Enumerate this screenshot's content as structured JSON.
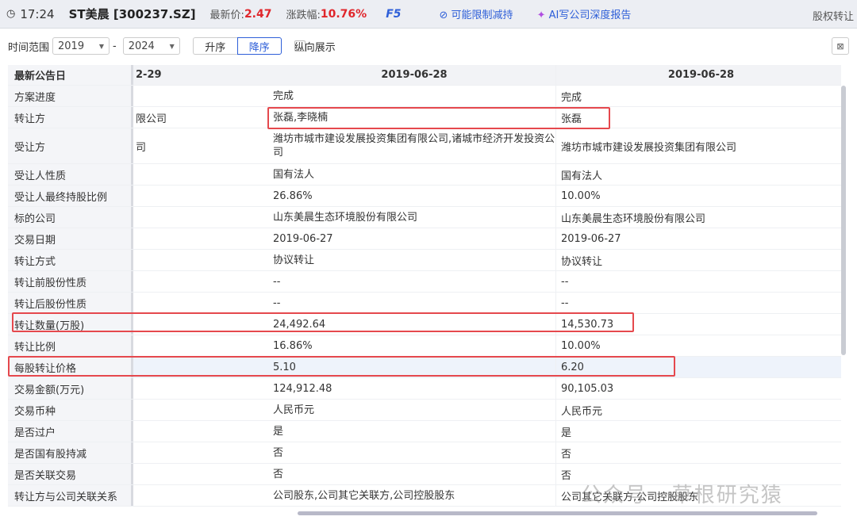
{
  "header": {
    "time": "17:24",
    "stock": "ST美晨 [300237.SZ]",
    "price_label": "最新价:",
    "price": "2.47",
    "change_label": "涨跌幅:",
    "change": "10.76%",
    "f5": "F5",
    "limit_link": "可能限制减持",
    "ai_link": "AI写公司深度报告",
    "page_title": "股权转让"
  },
  "toolbar": {
    "range_label": "时间范围",
    "from": "2019",
    "dash": "-",
    "to": "2024",
    "asc": "升序",
    "desc": "降序",
    "vertical": "纵向展示"
  },
  "table": {
    "headers": [
      "最新公告日",
      "2-29",
      "2019-06-28",
      "2019-06-28"
    ],
    "rows": [
      [
        "方案进度",
        "",
        "完成",
        "完成"
      ],
      [
        "转让方",
        "限公司",
        "张磊,李晓楠",
        "张磊"
      ],
      [
        "受让方",
        "司",
        "潍坊市城市建设发展投资集团有限公司,诸城市经济开发投资公司",
        "潍坊市城市建设发展投资集团有限公司"
      ],
      [
        "受让人性质",
        "",
        "国有法人",
        "国有法人"
      ],
      [
        "受让人最终持股比例",
        "",
        "26.86%",
        "10.00%"
      ],
      [
        "标的公司",
        "",
        "山东美晨生态环境股份有限公司",
        "山东美晨生态环境股份有限公司"
      ],
      [
        "交易日期",
        "",
        "2019-06-27",
        "2019-06-27"
      ],
      [
        "转让方式",
        "",
        "协议转让",
        "协议转让"
      ],
      [
        "转让前股份性质",
        "",
        "--",
        "--"
      ],
      [
        "转让后股份性质",
        "",
        "--",
        "--"
      ],
      [
        "转让数量(万股)",
        "",
        "24,492.64",
        "14,530.73"
      ],
      [
        "转让比例",
        "",
        "16.86%",
        "10.00%"
      ],
      [
        "每股转让价格",
        "",
        "5.10",
        "6.20"
      ],
      [
        "交易金额(万元)",
        "",
        "124,912.48",
        "90,105.03"
      ],
      [
        "交易币种",
        "",
        "人民币元",
        "人民币元"
      ],
      [
        "是否过户",
        "",
        "是",
        "是"
      ],
      [
        "是否国有股持减",
        "",
        "否",
        "否"
      ],
      [
        "是否关联交易",
        "",
        "否",
        "否"
      ],
      [
        "转让方与公司关联关系",
        "",
        "公司股东,公司其它关联方,公司控股股东",
        "公司其它关联方,公司控股股东"
      ]
    ]
  },
  "watermark": "公众号 · 草根研究猿"
}
